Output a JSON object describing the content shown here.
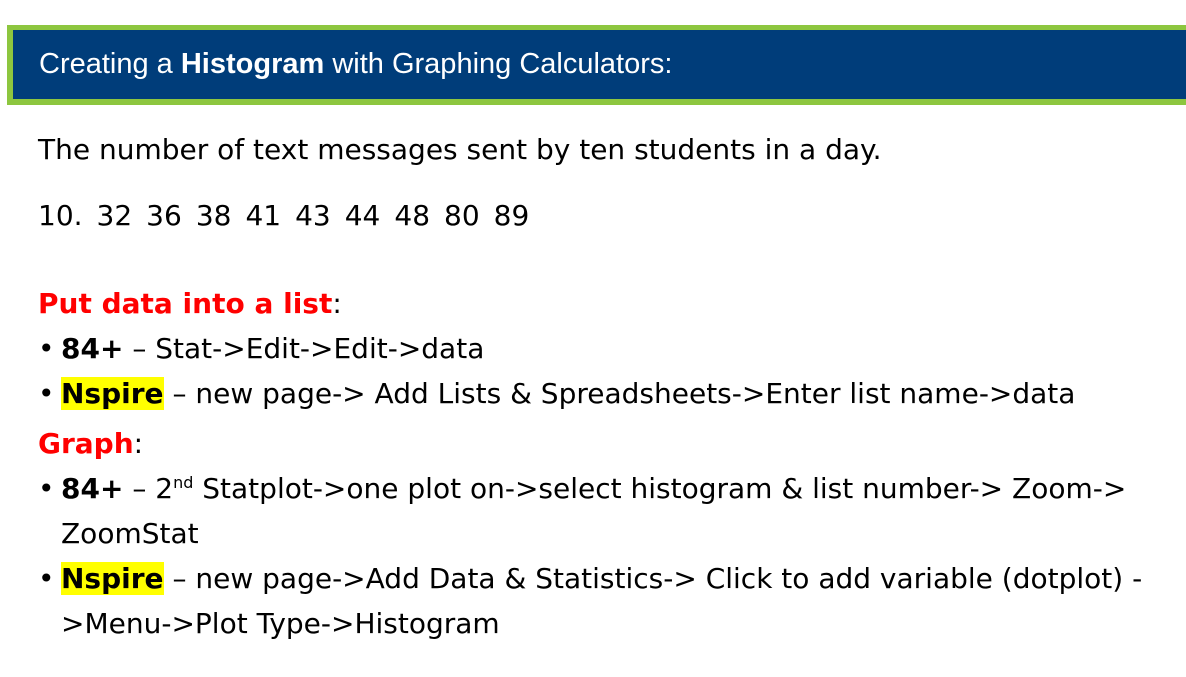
{
  "header": {
    "title_prefix": "Creating a ",
    "title_bold": "Histogram",
    "title_suffix": " with Graphing Calculators:"
  },
  "intro": "The number of text messages sent by ten students in a day.",
  "data_values": [
    "10.",
    "32",
    "36",
    "38",
    "41",
    "43",
    "44",
    "48",
    "80",
    "89"
  ],
  "put_data": {
    "title": "Put data into a list",
    "colon": ":",
    "items": [
      {
        "device": "84+",
        "separator": " – ",
        "text": "Stat->Edit->Edit->data"
      },
      {
        "device": "Nspire",
        "separator": " – ",
        "text": "new page-> Add Lists & Spreadsheets->Enter list name->data"
      }
    ]
  },
  "graph": {
    "title": "Graph",
    "colon": ":",
    "items": [
      {
        "device": "84+",
        "separator": " – ",
        "pre": "2",
        "sup": "nd",
        "text": " Statplot->one plot on->select histogram & list number-> Zoom-> ZoomStat"
      },
      {
        "device": "Nspire",
        "separator": " – ",
        "text": "new page->Add Data & Statistics-> Click to add variable (dotplot) ->Menu->Plot Type->Histogram"
      }
    ]
  },
  "colors": {
    "header_bg": "#003d7a",
    "header_border": "#8dc63f",
    "section_title": "#ff0000",
    "highlight": "#ffff00"
  }
}
